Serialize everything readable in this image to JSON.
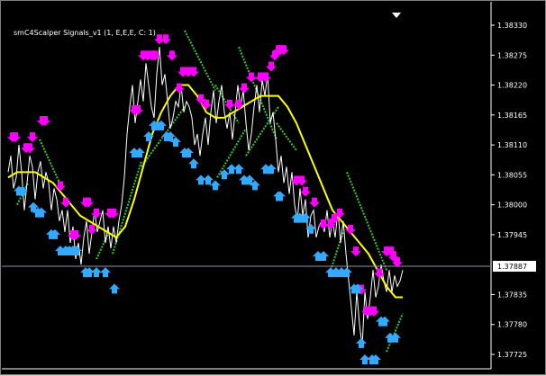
{
  "chart_data": {
    "type": "line",
    "indicator_label": "smC4Scalper Signals_v1 (1, E,E,E, C: 1)",
    "y_ticks": [
      "1.38330",
      "1.38275",
      "1.38220",
      "1.38165",
      "1.38110",
      "1.38055",
      "1.38000",
      "1.37945",
      "1.37887",
      "1.37835",
      "1.37780",
      "1.37725"
    ],
    "current_price": "1.37887",
    "ylim": [
      1.37725,
      1.3833
    ],
    "colors": {
      "background": "#000000",
      "price": "#ffffff",
      "ma": "#ffff00",
      "trail": "#33cc33",
      "sell": "#ff00ff",
      "buy": "#33aaff",
      "grid_line": "#8899aa",
      "badge_bg": "#ffffff",
      "badge_text": "#000000"
    },
    "series": [
      {
        "key": "price",
        "x": [
          0,
          3,
          6,
          9,
          12,
          15,
          18,
          21,
          24,
          27,
          30,
          33,
          36,
          39,
          42,
          45,
          48,
          51,
          54,
          57,
          60,
          63,
          66,
          69,
          72,
          75,
          78,
          81,
          84,
          87,
          90,
          93,
          96,
          99,
          102,
          105,
          108,
          111,
          114,
          117,
          120,
          123,
          126,
          129,
          132,
          135,
          138,
          141,
          144,
          147,
          150,
          153,
          156,
          159,
          162,
          165,
          168,
          171,
          174,
          177,
          180,
          183,
          186,
          189,
          192,
          195,
          198,
          201,
          204,
          207,
          210,
          213,
          216,
          219,
          222,
          225,
          228,
          231,
          234,
          237,
          240,
          243,
          246,
          249,
          252,
          255,
          258,
          261,
          264,
          267,
          270,
          273,
          276,
          279,
          282,
          285,
          288,
          291,
          294,
          297,
          300,
          303,
          306,
          309,
          312,
          315,
          318,
          321,
          324,
          327,
          330,
          333,
          336,
          339,
          342,
          345,
          348,
          351,
          354,
          357,
          360,
          363,
          366,
          369,
          372,
          375,
          378,
          381,
          384,
          387,
          390,
          393,
          396,
          399,
          402,
          405,
          408,
          411,
          414,
          417,
          420,
          423,
          426,
          429,
          432,
          435,
          438
        ],
        "y": [
          1.3806,
          1.3809,
          1.3803,
          1.3805,
          1.3811,
          1.3806,
          1.3799,
          1.3804,
          1.3809,
          1.3807,
          1.3801,
          1.3806,
          1.3808,
          1.3803,
          1.3806,
          1.3804,
          1.3799,
          1.3803,
          1.3801,
          1.3797,
          1.3799,
          1.3795,
          1.3799,
          1.3793,
          1.3796,
          1.379,
          1.3793,
          1.3789,
          1.3794,
          1.3797,
          1.3791,
          1.3795,
          1.3799,
          1.3795,
          1.3797,
          1.3799,
          1.3793,
          1.3796,
          1.3792,
          1.3796,
          1.3793,
          1.3797,
          1.38,
          1.3805,
          1.3813,
          1.3818,
          1.3822,
          1.3815,
          1.3819,
          1.3823,
          1.3819,
          1.3826,
          1.3822,
          1.3818,
          1.3816,
          1.3824,
          1.3829,
          1.3822,
          1.3824,
          1.3819,
          1.3814,
          1.3816,
          1.3819,
          1.3818,
          1.3822,
          1.3817,
          1.3819,
          1.3818,
          1.3816,
          1.3811,
          1.3813,
          1.3809,
          1.3813,
          1.3816,
          1.3811,
          1.3817,
          1.3821,
          1.3815,
          1.3819,
          1.3822,
          1.3817,
          1.3814,
          1.3817,
          1.3812,
          1.3817,
          1.3822,
          1.3818,
          1.3821,
          1.3815,
          1.381,
          1.3813,
          1.3818,
          1.3822,
          1.3817,
          1.3823,
          1.382,
          1.3824,
          1.3815,
          1.3817,
          1.3812,
          1.3806,
          1.3809,
          1.3804,
          1.3807,
          1.3802,
          1.3806,
          1.38,
          1.3797,
          1.3803,
          1.3798,
          1.3801,
          1.3794,
          1.3798,
          1.3799,
          1.3794,
          1.3796,
          1.3797,
          1.3795,
          1.3799,
          1.3794,
          1.3797,
          1.3794,
          1.3799,
          1.3793,
          1.3797,
          1.3791,
          1.3786,
          1.3781,
          1.3776,
          1.3784,
          1.3778,
          1.3774,
          1.3784,
          1.3779,
          1.3783,
          1.3788,
          1.3783,
          1.3785,
          1.3789,
          1.3786,
          1.3784,
          1.3788,
          1.3784,
          1.3787,
          1.3785,
          1.3786,
          1.3788
        ]
      },
      {
        "key": "ma",
        "x": [
          0,
          10,
          20,
          30,
          40,
          50,
          60,
          70,
          80,
          90,
          100,
          110,
          120,
          130,
          140,
          150,
          160,
          170,
          180,
          190,
          200,
          210,
          220,
          230,
          240,
          250,
          260,
          270,
          280,
          290,
          300,
          310,
          320,
          330,
          340,
          350,
          360,
          370,
          380,
          390,
          400,
          410,
          420,
          430,
          438
        ],
        "y": [
          1.3805,
          1.3806,
          1.3806,
          1.3806,
          1.3805,
          1.3804,
          1.3802,
          1.38,
          1.3798,
          1.3797,
          1.3796,
          1.3795,
          1.3794,
          1.3796,
          1.3801,
          1.3807,
          1.3813,
          1.3817,
          1.382,
          1.3822,
          1.3822,
          1.382,
          1.3817,
          1.3816,
          1.3816,
          1.3817,
          1.3818,
          1.3819,
          1.382,
          1.382,
          1.382,
          1.3818,
          1.3815,
          1.3811,
          1.3807,
          1.3803,
          1.3799,
          1.3797,
          1.3795,
          1.3793,
          1.3791,
          1.3788,
          1.3785,
          1.3783,
          1.3783
        ]
      }
    ],
    "trail_segments": [
      {
        "x": [
          10,
          22
        ],
        "y": [
          1.38,
          1.3804
        ]
      },
      {
        "x": [
          35,
          60
        ],
        "y": [
          1.3812,
          1.3803
        ]
      },
      {
        "x": [
          98,
          112
        ],
        "y": [
          1.379,
          1.3795
        ]
      },
      {
        "x": [
          116,
          148
        ],
        "y": [
          1.3791,
          1.3808
        ]
      },
      {
        "x": [
          148,
          196
        ],
        "y": [
          1.3807,
          1.3818
        ]
      },
      {
        "x": [
          196,
          230
        ],
        "y": [
          1.3832,
          1.3821
        ]
      },
      {
        "x": [
          230,
          256
        ],
        "y": [
          1.3822,
          1.3815
        ]
      },
      {
        "x": [
          256,
          298
        ],
        "y": [
          1.3829,
          1.3812
        ]
      },
      {
        "x": [
          232,
          264
        ],
        "y": [
          1.3805,
          1.3814
        ]
      },
      {
        "x": [
          264,
          300
        ],
        "y": [
          1.3809,
          1.3818
        ]
      },
      {
        "x": [
          298,
          320
        ],
        "y": [
          1.3815,
          1.381
        ]
      },
      {
        "x": [
          358,
          372
        ],
        "y": [
          1.3788,
          1.3795
        ]
      },
      {
        "x": [
          376,
          420
        ],
        "y": [
          1.3806,
          1.3788
        ]
      },
      {
        "x": [
          420,
          438
        ],
        "y": [
          1.3773,
          1.378
        ]
      }
    ],
    "sell_arrows": {
      "x": [
        5,
        8,
        20,
        24,
        27,
        38,
        41,
        58,
        64,
        72,
        75,
        86,
        89,
        93,
        98,
        113,
        117,
        140,
        144,
        150,
        155,
        160,
        163,
        168,
        175,
        182,
        190,
        194,
        200,
        206,
        214,
        220,
        246,
        256,
        262,
        270,
        280,
        286,
        292,
        296,
        300,
        302,
        306,
        320,
        326,
        330,
        340,
        350,
        358,
        362,
        368,
        380,
        386,
        392,
        398,
        402,
        406,
        412,
        420,
        425,
        428,
        432
      ],
      "y": [
        1.3811,
        1.3811,
        1.3809,
        1.3809,
        1.3811,
        1.3814,
        1.3814,
        1.3802,
        1.3799,
        1.3793,
        1.3793,
        1.3799,
        1.3799,
        1.3794,
        1.3797,
        1.3797,
        1.3797,
        1.3816,
        1.3816,
        1.3826,
        1.3826,
        1.3826,
        1.3826,
        1.3829,
        1.3829,
        1.3826,
        1.382,
        1.3823,
        1.3823,
        1.3823,
        1.3818,
        1.3817,
        1.3817,
        1.3817,
        1.382,
        1.3822,
        1.3822,
        1.3822,
        1.3824,
        1.3826,
        1.3827,
        1.3827,
        1.3827,
        1.3803,
        1.3803,
        1.3801,
        1.3799,
        1.3795,
        1.3795,
        1.3796,
        1.3797,
        1.3794,
        1.379,
        1.3783,
        1.3779,
        1.3779,
        1.3779,
        1.3786,
        1.379,
        1.379,
        1.3789,
        1.3788
      ]
    },
    "buy_arrows": {
      "x": [
        12,
        16,
        28,
        33,
        37,
        48,
        52,
        58,
        64,
        68,
        72,
        76,
        86,
        90,
        98,
        108,
        118,
        140,
        146,
        156,
        162,
        166,
        170,
        176,
        180,
        186,
        196,
        200,
        206,
        214,
        222,
        230,
        240,
        248,
        256,
        262,
        268,
        274,
        286,
        292,
        300,
        302,
        320,
        324,
        330,
        336,
        344,
        350,
        358,
        364,
        370,
        376,
        384,
        388,
        392,
        396,
        404,
        408,
        414,
        418,
        424,
        430
      ],
      "y": [
        1.3804,
        1.3804,
        1.3801,
        1.38,
        1.38,
        1.3796,
        1.3796,
        1.3793,
        1.3793,
        1.3793,
        1.3793,
        1.3793,
        1.3789,
        1.3789,
        1.3789,
        1.3789,
        1.3786,
        1.3811,
        1.3811,
        1.3814,
        1.3816,
        1.3816,
        1.3816,
        1.3814,
        1.3814,
        1.3813,
        1.3811,
        1.3811,
        1.3809,
        1.3806,
        1.3806,
        1.3805,
        1.3807,
        1.3808,
        1.3808,
        1.3806,
        1.3806,
        1.3805,
        1.3808,
        1.3808,
        1.3803,
        1.3803,
        1.3799,
        1.3799,
        1.3799,
        1.3797,
        1.3792,
        1.3792,
        1.3789,
        1.3789,
        1.3789,
        1.3789,
        1.3786,
        1.3786,
        1.3776,
        1.3773,
        1.3773,
        1.3773,
        1.378,
        1.378,
        1.3777,
        1.3777
      ]
    }
  }
}
